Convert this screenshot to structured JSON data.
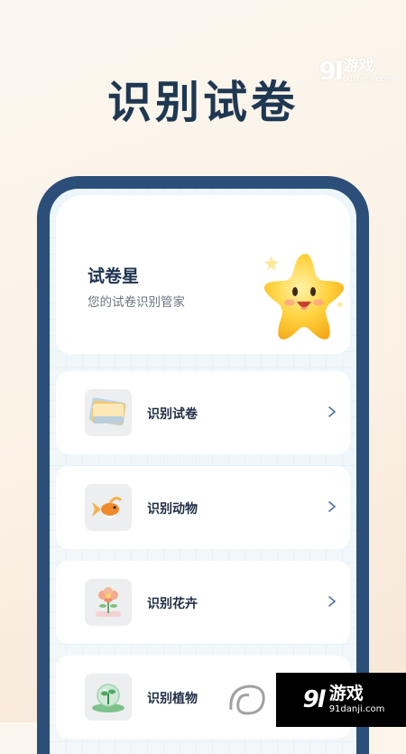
{
  "page_title": "识别试卷",
  "watermark": {
    "number": "9l",
    "brand": "游戏",
    "domain": "91danji.com"
  },
  "hero": {
    "title": "试卷星",
    "subtitle": "您的试卷识别管家",
    "icon": "star-mascot-icon"
  },
  "menu": [
    {
      "label": "识别试卷",
      "icon": "paper-stack-icon"
    },
    {
      "label": "识别动物",
      "icon": "goldfish-icon"
    },
    {
      "label": "识别花卉",
      "icon": "flower-icon"
    },
    {
      "label": "识别植物",
      "icon": "plant-globe-icon"
    }
  ],
  "colors": {
    "frame": "#2b4f79",
    "title": "#1f3852",
    "chevron": "#4a6fa5"
  }
}
